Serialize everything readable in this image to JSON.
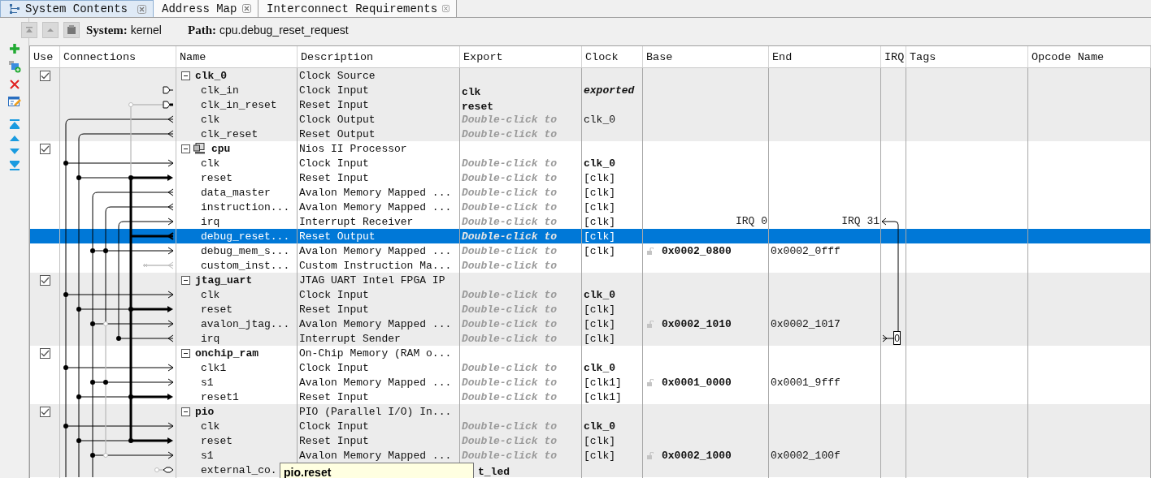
{
  "tabs": [
    {
      "label": "System Contents",
      "selected": true
    },
    {
      "label": "Address Map",
      "selected": false
    },
    {
      "label": "Interconnect Requirements",
      "selected": false
    }
  ],
  "toolbar": {
    "system_label": "System:",
    "system": "kernel",
    "path_label": "Path:",
    "path": "cpu.debug_reset_request"
  },
  "table": {
    "columns": [
      "Use",
      "Connections",
      "Name",
      "Description",
      "Export",
      "Clock",
      "Base",
      "End",
      "IRQ",
      "Tags",
      "Opcode Name"
    ],
    "components": [
      {
        "name": "clk_0",
        "kind": "component",
        "description": "Clock Source",
        "checked": true,
        "expanded": true,
        "selected": false,
        "children": [
          {
            "name": "clk_in",
            "description": "Clock Input",
            "selected": false,
            "export": {
              "text": "clk",
              "kind": "name"
            },
            "clock": {
              "text": "exported",
              "kind": "exported"
            }
          },
          {
            "name": "clk_in_reset",
            "description": "Reset Input",
            "selected": false,
            "export": {
              "text": "reset",
              "kind": "name"
            }
          },
          {
            "name": "clk",
            "description": "Clock Output",
            "selected": false,
            "export": {
              "text": "Double-click to",
              "kind": "hint"
            },
            "clock": {
              "text": "clk_0",
              "kind": "plain"
            }
          },
          {
            "name": "clk_reset",
            "description": "Reset Output",
            "selected": false,
            "export": {
              "text": "Double-click to",
              "kind": "hint"
            }
          }
        ]
      },
      {
        "name": "cpu",
        "kind": "processor",
        "description": "Nios II Processor",
        "checked": true,
        "expanded": true,
        "selected": false,
        "children": [
          {
            "name": "clk",
            "description": "Clock Input",
            "selected": false,
            "export": {
              "text": "Double-click to",
              "kind": "hint"
            },
            "clock": {
              "text": "clk_0",
              "kind": "bold"
            }
          },
          {
            "name": "reset",
            "description": "Reset Input",
            "selected": false,
            "export": {
              "text": "Double-click to",
              "kind": "hint"
            },
            "clock": {
              "text": "[clk]",
              "kind": "plain"
            }
          },
          {
            "name": "data_master",
            "description": "Avalon Memory Mapped ...",
            "selected": false,
            "export": {
              "text": "Double-click to",
              "kind": "hint"
            },
            "clock": {
              "text": "[clk]",
              "kind": "plain"
            }
          },
          {
            "name": "instruction...",
            "description": "Avalon Memory Mapped ...",
            "selected": false,
            "export": {
              "text": "Double-click to",
              "kind": "hint"
            },
            "clock": {
              "text": "[clk]",
              "kind": "plain"
            }
          },
          {
            "name": "irq",
            "description": "Interrupt Receiver",
            "selected": false,
            "export": {
              "text": "Double-click to",
              "kind": "hint"
            },
            "clock": {
              "text": "[clk]",
              "kind": "plain"
            },
            "irq_range": {
              "start": "IRQ 0",
              "end": "IRQ 31"
            }
          },
          {
            "name": "debug_reset...",
            "description": "Reset Output",
            "selected": true,
            "export": {
              "text": "Double-click to",
              "kind": "hint"
            },
            "clock": {
              "text": "[clk]",
              "kind": "plain"
            }
          },
          {
            "name": "debug_mem_s...",
            "description": "Avalon Memory Mapped ...",
            "selected": false,
            "export": {
              "text": "Double-click to",
              "kind": "hint"
            },
            "clock": {
              "text": "[clk]",
              "kind": "plain"
            },
            "base": "0x0002_0800",
            "end": "0x0002_0fff"
          },
          {
            "name": "custom_inst...",
            "description": "Custom Instruction Ma...",
            "selected": false,
            "export": {
              "text": "Double-click to",
              "kind": "hint"
            }
          }
        ]
      },
      {
        "name": "jtag_uart",
        "kind": "component",
        "description": "JTAG UART Intel FPGA IP",
        "checked": true,
        "expanded": true,
        "selected": false,
        "children": [
          {
            "name": "clk",
            "description": "Clock Input",
            "selected": false,
            "export": {
              "text": "Double-click to",
              "kind": "hint"
            },
            "clock": {
              "text": "clk_0",
              "kind": "bold"
            }
          },
          {
            "name": "reset",
            "description": "Reset Input",
            "selected": false,
            "export": {
              "text": "Double-click to",
              "kind": "hint"
            },
            "clock": {
              "text": "[clk]",
              "kind": "plain"
            }
          },
          {
            "name": "avalon_jtag...",
            "description": "Avalon Memory Mapped ...",
            "selected": false,
            "export": {
              "text": "Double-click to",
              "kind": "hint"
            },
            "clock": {
              "text": "[clk]",
              "kind": "plain"
            },
            "base": "0x0002_1010",
            "end": "0x0002_1017"
          },
          {
            "name": "irq",
            "description": "Interrupt Sender",
            "selected": false,
            "export": {
              "text": "Double-click to",
              "kind": "hint"
            },
            "clock": {
              "text": "[clk]",
              "kind": "plain"
            },
            "irq_number": "0"
          }
        ]
      },
      {
        "name": "onchip_ram",
        "kind": "component",
        "description": "On-Chip Memory (RAM o...",
        "checked": true,
        "expanded": true,
        "selected": false,
        "children": [
          {
            "name": "clk1",
            "description": "Clock Input",
            "selected": false,
            "export": {
              "text": "Double-click to",
              "kind": "hint"
            },
            "clock": {
              "text": "clk_0",
              "kind": "bold"
            }
          },
          {
            "name": "s1",
            "description": "Avalon Memory Mapped ...",
            "selected": false,
            "export": {
              "text": "Double-click to",
              "kind": "hint"
            },
            "clock": {
              "text": "[clk1]",
              "kind": "plain"
            },
            "base": "0x0001_0000",
            "end": "0x0001_9fff"
          },
          {
            "name": "reset1",
            "description": "Reset Input",
            "selected": false,
            "export": {
              "text": "Double-click to",
              "kind": "hint"
            },
            "clock": {
              "text": "[clk1]",
              "kind": "plain"
            }
          }
        ]
      },
      {
        "name": "pio",
        "kind": "component",
        "description": "PIO (Parallel I/O) In...",
        "checked": true,
        "expanded": true,
        "selected": false,
        "children": [
          {
            "name": "clk",
            "description": "Clock Input",
            "selected": false,
            "export": {
              "text": "Double-click to",
              "kind": "hint"
            },
            "clock": {
              "text": "clk_0",
              "kind": "bold"
            }
          },
          {
            "name": "reset",
            "description": "Reset Input",
            "selected": false,
            "export": {
              "text": "Double-click to",
              "kind": "hint"
            },
            "clock": {
              "text": "[clk]",
              "kind": "plain"
            }
          },
          {
            "name": "s1",
            "description": "Avalon Memory Mapped ...",
            "selected": false,
            "export": {
              "text": "Double-click to",
              "kind": "hint"
            },
            "clock": {
              "text": "[clk]",
              "kind": "plain"
            },
            "base": "0x0002_1000",
            "end": "0x0002_100f"
          },
          {
            "name": "external_co.",
            "selected": false,
            "export": {
              "text": "t_led",
              "kind": "name"
            }
          }
        ]
      }
    ]
  },
  "tooltip": {
    "text": "pio.reset"
  }
}
